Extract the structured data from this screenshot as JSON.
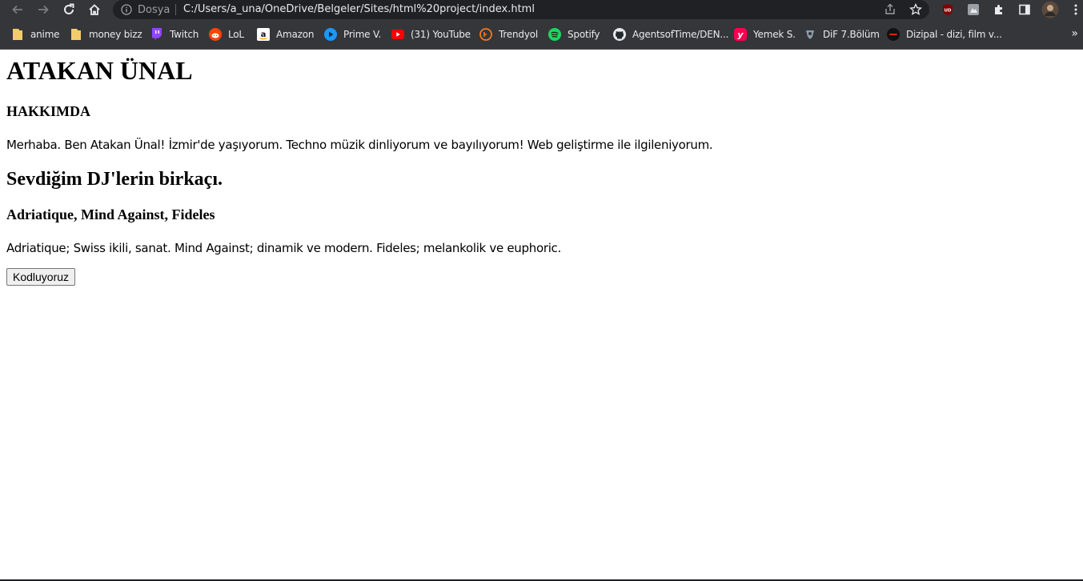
{
  "browser": {
    "site_info_label": "Dosya",
    "url": "C:/Users/a_una/OneDrive/Belgeler/Sites/html%20project/index.html",
    "icons": [
      "back-icon",
      "forward-icon",
      "reload-icon",
      "home-icon",
      "info-icon",
      "share-icon",
      "star-icon",
      "ublock-icon",
      "extension-icon",
      "puzzle-icon",
      "sidepanel-icon",
      "profile-avatar",
      "menu-icon"
    ]
  },
  "bookmarks": {
    "items": [
      {
        "label": "anime",
        "icon": "folder-icon"
      },
      {
        "label": "money bizz",
        "icon": "folder-icon"
      },
      {
        "label": "Twitch",
        "icon": "twitch-icon"
      },
      {
        "label": "LoL",
        "icon": "reddit-icon"
      },
      {
        "label": "Amazon",
        "icon": "amazon-icon"
      },
      {
        "label": "Prime V.",
        "icon": "prime-video-icon"
      },
      {
        "label": "(31) YouTube",
        "icon": "youtube-icon"
      },
      {
        "label": "Trendyol",
        "icon": "trendyol-icon"
      },
      {
        "label": "Spotify",
        "icon": "spotify-icon"
      },
      {
        "label": "AgentsofTime/DEN...",
        "icon": "github-icon"
      },
      {
        "label": "Yemek S.",
        "icon": "yemeksepeti-icon"
      },
      {
        "label": "DiF 7.Bölüm",
        "icon": "dif-icon"
      },
      {
        "label": "Dizipal - dizi, film v...",
        "icon": "dizipal-icon"
      }
    ],
    "more": "»"
  },
  "page": {
    "title": "ATAKAN ÜNAL",
    "about_heading": "HAKKIMDA",
    "about_text": "Merhaba. Ben Atakan Ünal! İzmir'de yaşıyorum. Techno müzik dinliyorum ve bayılıyorum! Web geliştirme ile ilgileniyorum.",
    "dj_heading": "Sevdiğim DJ'lerin birkaçı.",
    "dj_subheading": "Adriatique, Mind Against, Fideles",
    "dj_text": "Adriatique; Swiss ikili, sanat. Mind Against; dinamik ve modern. Fideles; melankolik ve euphoric.",
    "button_label": "Kodluyoruz"
  },
  "colors": {
    "chrome_toolbar": "#35363a",
    "omnibox": "#202124",
    "chrome_text": "#e8eaed",
    "page_background": "#ffffff"
  }
}
